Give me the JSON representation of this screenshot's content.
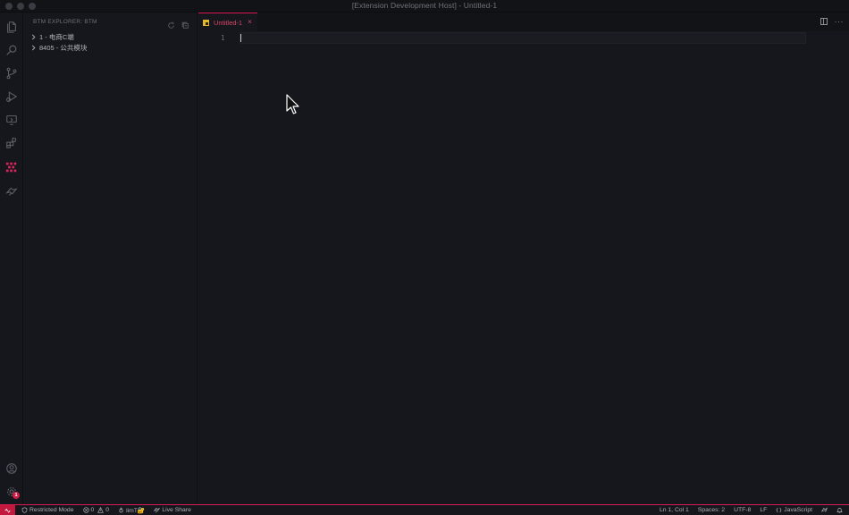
{
  "window": {
    "title": "[Extension Development Host] - Untitled-1"
  },
  "activity_bar": {
    "items": [
      "files-icon",
      "search-icon",
      "source-control-icon",
      "run-debug-icon",
      "remote-explorer-icon",
      "extensions-icon",
      "btm-explorer-icon",
      "live-share-icon"
    ],
    "bottom": [
      "account-icon",
      "settings-gear-icon"
    ],
    "settings_badge": "1"
  },
  "sidebar": {
    "header": "BTM EXPLORER: BTM",
    "items": [
      {
        "label": "1 - 电商C端"
      },
      {
        "label": "8405 - 公共模块"
      }
    ]
  },
  "editor": {
    "tab": {
      "label": "Untitled-1",
      "close": "×"
    },
    "line_numbers": [
      "1"
    ]
  },
  "status_bar": {
    "restricted_mode": "Restricted Mode",
    "errors": "0",
    "warnings": "0",
    "branch": "limT🔐",
    "live_share": "Live Share",
    "position": "Ln 1, Col 1",
    "spaces": "Spaces: 2",
    "encoding": "UTF-8",
    "eol": "LF",
    "language": "JavaScript"
  },
  "colors": {
    "accent": "#d91b4f",
    "background": "#16171c",
    "active_icon": "#e0245e"
  }
}
